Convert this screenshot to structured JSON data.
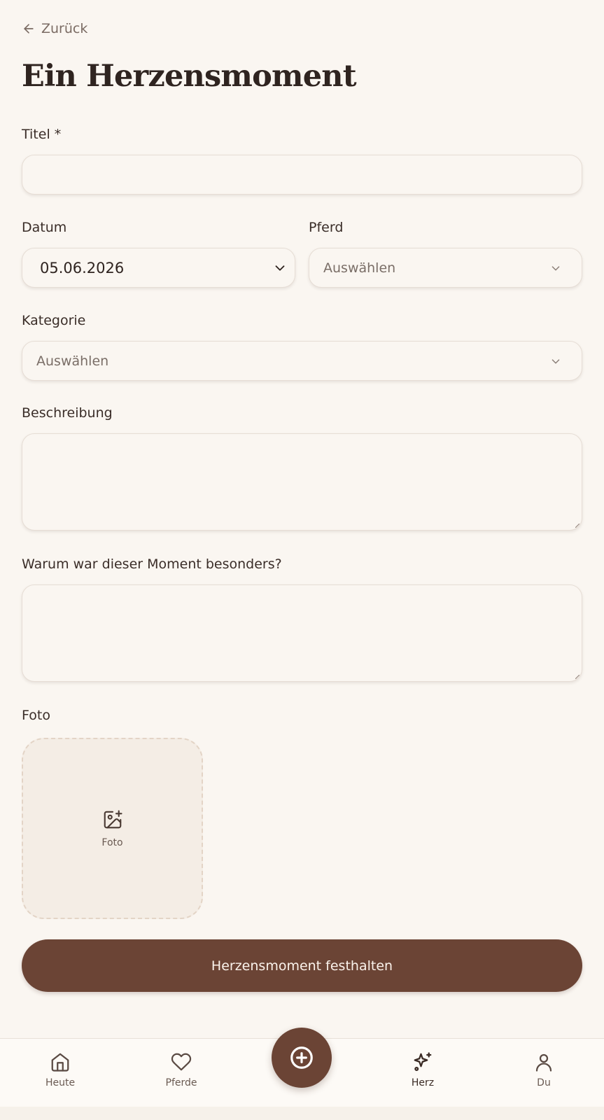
{
  "header": {
    "back_label": "Zurück",
    "title": "Ein Herzensmoment"
  },
  "form": {
    "title_label": "Titel *",
    "title_value": "",
    "date_label": "Datum",
    "date_value": "05.06.2026",
    "horse_label": "Pferd",
    "horse_placeholder": "Auswählen",
    "category_label": "Kategorie",
    "category_placeholder": "Auswählen",
    "description_label": "Beschreibung",
    "description_value": "",
    "why_label": "Warum war dieser Moment besonders?",
    "why_value": "",
    "photo_label": "Foto",
    "photo_caption": "Foto",
    "submit_label": "Herzensmoment festhalten"
  },
  "nav": {
    "items": [
      {
        "label": "Heute",
        "icon": "home-icon"
      },
      {
        "label": "Pferde",
        "icon": "heart-icon"
      },
      {
        "label": "Herz",
        "icon": "sparkles-icon"
      },
      {
        "label": "Du",
        "icon": "user-icon"
      }
    ],
    "fab_icon": "plus-circle-icon",
    "active": "Herz"
  },
  "colors": {
    "background": "#faf6f1",
    "accent": "#6b4435",
    "text": "#2f2420",
    "muted": "#7a6e67"
  }
}
